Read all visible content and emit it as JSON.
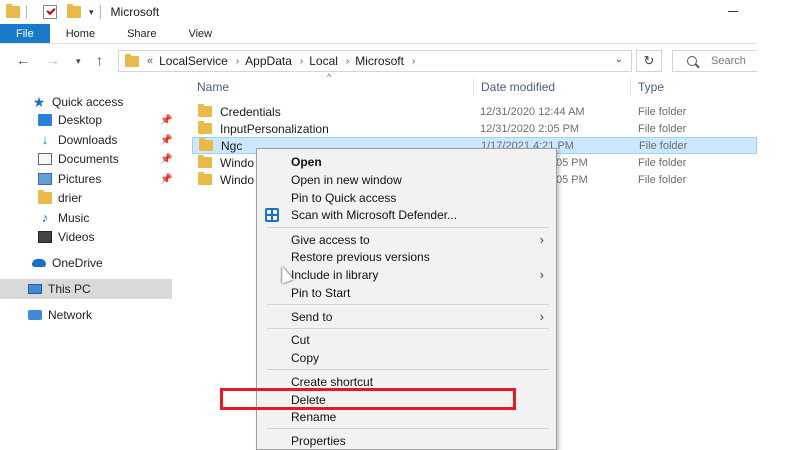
{
  "window": {
    "title": "Microsoft"
  },
  "ribbon": {
    "tabs": [
      "File",
      "Home",
      "Share",
      "View"
    ]
  },
  "address": {
    "lead": "«",
    "crumbs": [
      "LocalService",
      "AppData",
      "Local",
      "Microsoft"
    ],
    "search_placeholder": "Search"
  },
  "sidebar": {
    "items": [
      {
        "label": "Quick access",
        "icon": "star-icon"
      },
      {
        "label": "Desktop",
        "icon": "desktop-icon",
        "pinned": true
      },
      {
        "label": "Downloads",
        "icon": "downloads-icon",
        "pinned": true
      },
      {
        "label": "Documents",
        "icon": "documents-icon",
        "pinned": true
      },
      {
        "label": "Pictures",
        "icon": "pictures-icon",
        "pinned": true
      },
      {
        "label": "drier",
        "icon": "folder-icon"
      },
      {
        "label": "Music",
        "icon": "music-icon"
      },
      {
        "label": "Videos",
        "icon": "videos-icon"
      },
      {
        "label": "OneDrive",
        "icon": "onedrive-icon"
      },
      {
        "label": "This PC",
        "icon": "this-pc-icon",
        "selected": true
      },
      {
        "label": "Network",
        "icon": "network-icon"
      }
    ]
  },
  "columns": {
    "name": "Name",
    "date": "Date modified",
    "type": "Type"
  },
  "files": [
    {
      "name": "Credentials",
      "date": "12/31/2020 12:44 AM",
      "type": "File folder"
    },
    {
      "name": "InputPersonalization",
      "date": "12/31/2020 2:05 PM",
      "type": "File folder"
    },
    {
      "name": "Ngc",
      "date": "1/17/2021 4:21 PM",
      "type": "File folder",
      "selected": true
    },
    {
      "name": "Windo",
      "date": "05 PM",
      "type": "File folder"
    },
    {
      "name": "Windo",
      "date": "05 PM",
      "type": "File folder"
    }
  ],
  "context_menu": {
    "items": {
      "open": "Open",
      "open_new_window": "Open in new window",
      "pin_quick_access": "Pin to Quick access",
      "scan_defender": "Scan with Microsoft Defender...",
      "give_access": "Give access to",
      "restore_versions": "Restore previous versions",
      "include_library": "Include in library",
      "pin_start": "Pin to Start",
      "send_to": "Send to",
      "cut": "Cut",
      "copy": "Copy",
      "create_shortcut": "Create shortcut",
      "delete": "Delete",
      "rename": "Rename",
      "properties": "Properties"
    }
  },
  "colors": {
    "file_tab": "#1979ca",
    "selection": "#cce8ff",
    "highlight_box": "#e21b25"
  }
}
